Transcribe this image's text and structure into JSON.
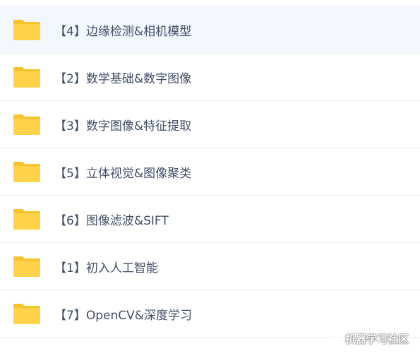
{
  "folders": [
    {
      "label": "【4】边缘检测&相机模型",
      "icon": "folder-icon",
      "selected": true
    },
    {
      "label": "【2】数学基础&数字图像",
      "icon": "folder-icon"
    },
    {
      "label": "【3】数字图像&特征提取",
      "icon": "folder-icon"
    },
    {
      "label": "【5】立体视觉&图像聚类",
      "icon": "folder-icon"
    },
    {
      "label": "【6】图像滤波&SIFT",
      "icon": "folder-icon"
    },
    {
      "label": "【1】初入人工智能",
      "icon": "folder-icon"
    },
    {
      "label": "【7】OpenCV&深度学习",
      "icon": "folder-icon"
    }
  ],
  "watermark": {
    "text": "机器学习社区",
    "icon": "wechat-icon"
  },
  "colors": {
    "folder": "#ffd24a",
    "folder_tab": "#f5c330",
    "text": "#424e67",
    "divider": "#e8eef4",
    "selected_bg": "#f2f8fd"
  }
}
